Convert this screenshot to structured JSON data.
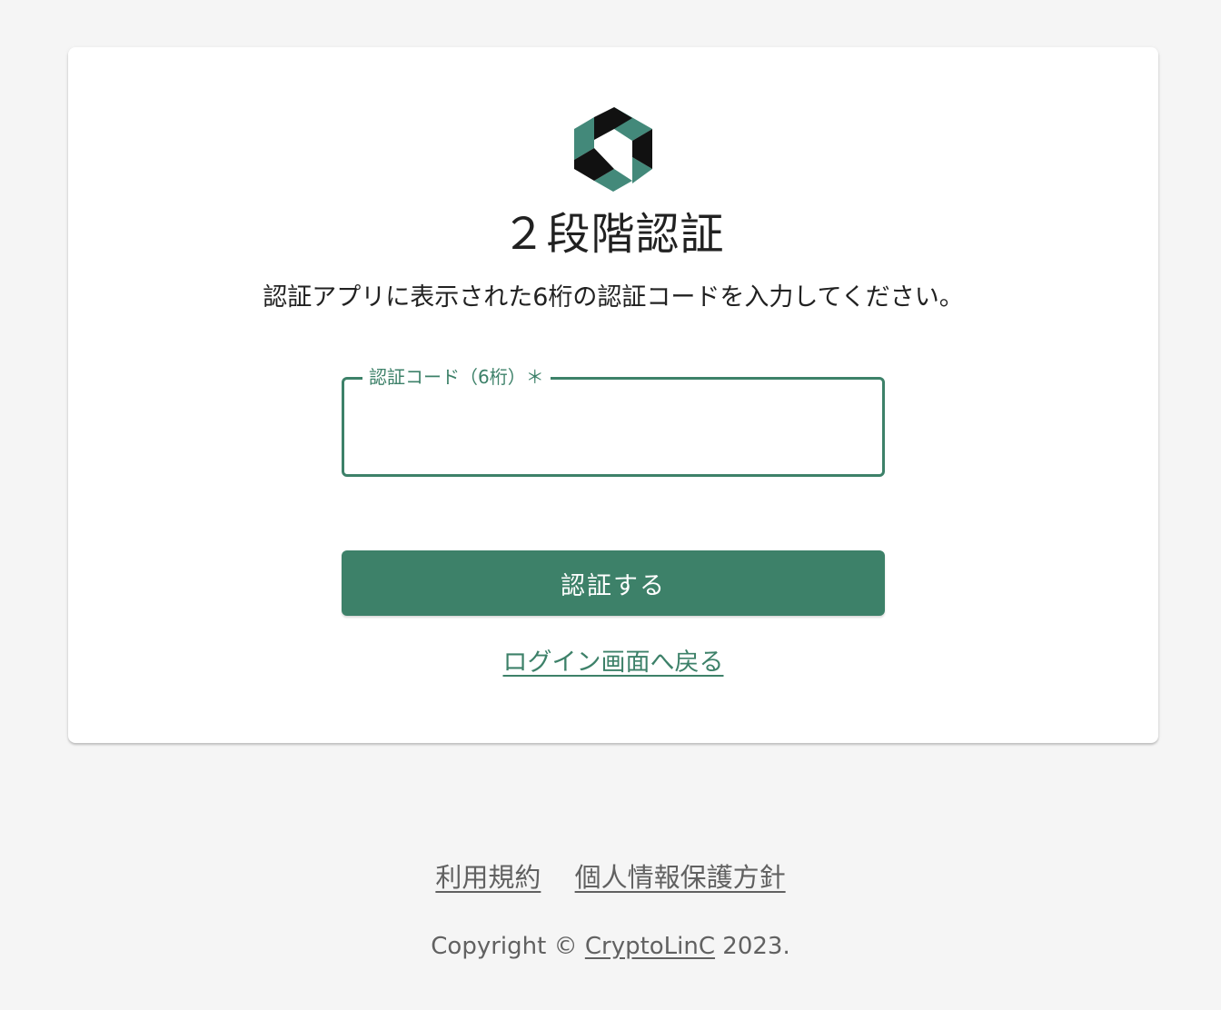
{
  "brand": {
    "accent_color": "#3d8169",
    "logo_icon": "hexagon-aperture-logo-icon"
  },
  "page": {
    "title": "２段階認証",
    "subtitle": "認証アプリに表示された6桁の認証コードを入力してください。"
  },
  "form": {
    "code_label": "認証コード（6桁）＊",
    "code_value": "",
    "submit_label": "認証する",
    "back_link": "ログイン画面へ戻る"
  },
  "footer": {
    "terms": "利用規約",
    "privacy": "個人情報保護方針",
    "copyright_prefix": "Copyright © ",
    "company": "CryptoLinC",
    "copyright_suffix": " 2023."
  }
}
